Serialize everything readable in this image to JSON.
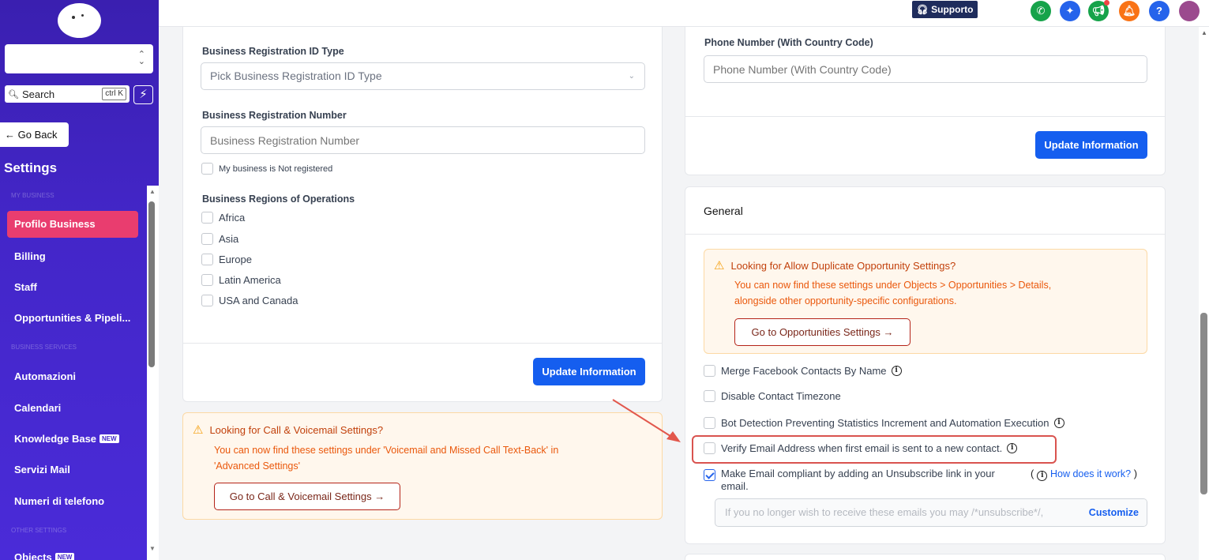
{
  "sidebar": {
    "search_label": "Search",
    "search_shortcut": "ctrl K",
    "go_back": "← Go Back",
    "settings_title": "Settings",
    "section_my_business": "MY BUSINESS",
    "section_business_services": "BUSINESS SERVICES",
    "section_other_settings": "OTHER SETTINGS",
    "items": [
      {
        "label": "Profilo Business",
        "active": true
      },
      {
        "label": "Billing"
      },
      {
        "label": "Staff"
      },
      {
        "label": "Opportunities & Pipeli..."
      },
      {
        "label": "Automazioni"
      },
      {
        "label": "Calendari"
      },
      {
        "label": "Knowledge Base",
        "badge": "NEW"
      },
      {
        "label": "Servizi Mail"
      },
      {
        "label": "Numeri di telefono"
      },
      {
        "label": "Objects",
        "badge": "NEW"
      }
    ]
  },
  "topbar": {
    "support_label": "Supporto",
    "icons": [
      "phone-icon",
      "sparkle-icon",
      "megaphone-icon",
      "bell-icon",
      "help-icon",
      "avatar"
    ]
  },
  "left_card": {
    "reg_id_type_label": "Business Registration ID Type",
    "reg_id_type_placeholder": "Pick Business Registration ID Type",
    "reg_number_label": "Business Registration Number",
    "reg_number_placeholder": "Business Registration Number",
    "not_registered_label": "My business is Not registered",
    "regions_label": "Business Regions of Operations",
    "regions": [
      "Africa",
      "Asia",
      "Europe",
      "Latin America",
      "USA and Canada"
    ],
    "update_button": "Update Information"
  },
  "call_alert": {
    "title": "Looking for Call & Voicemail Settings?",
    "line1": "You can now find these settings under 'Voicemail and Missed Call Text-Back' in",
    "line2": "'Advanced Settings'",
    "button": "Go to Call & Voicemail Settings"
  },
  "phone_card": {
    "label": "Phone Number (With Country Code)",
    "placeholder": "Phone Number (With Country Code)",
    "update_button": "Update Information"
  },
  "general_card": {
    "title": "General",
    "alert_title": "Looking for Allow Duplicate Opportunity Settings?",
    "alert_line1": "You can now find these settings under Objects > Opportunities > Details,",
    "alert_line2": "alongside other opportunity-specific configurations.",
    "alert_button": "Go to Opportunities Settings",
    "options": {
      "merge_facebook": "Merge Facebook Contacts By Name",
      "disable_timezone": "Disable Contact Timezone",
      "bot_detection": "Bot Detection Preventing Statistics Increment and Automation Execution",
      "verify_email": "Verify Email Address when first email is sent to a new contact.",
      "unsubscribe_line1": "Make Email compliant by adding an Unsubscribe link in your",
      "unsubscribe_line2": "email."
    },
    "how_link": "How does it work?",
    "paren_open": "(",
    "paren_close": ")",
    "unsub_placeholder": "If you no longer wish to receive these emails you may /*unsubscribe*/,",
    "customize": "Customize"
  }
}
